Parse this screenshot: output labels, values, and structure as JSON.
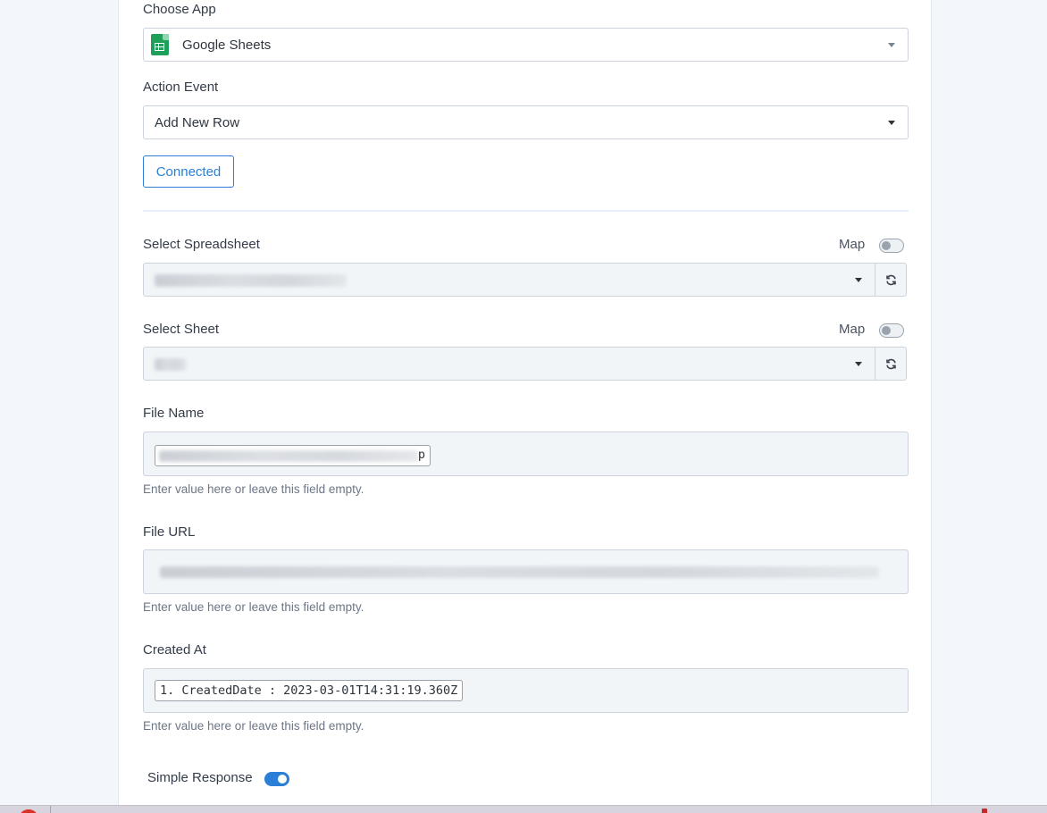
{
  "choose_app": {
    "label": "Choose App",
    "value": "Google Sheets",
    "icon": "google-sheets-icon"
  },
  "action_event": {
    "label": "Action Event",
    "value": "Add New Row"
  },
  "connected_button": "Connected",
  "select_spreadsheet": {
    "label": "Select Spreadsheet",
    "map_label": "Map",
    "map_enabled": false
  },
  "select_sheet": {
    "label": "Select Sheet",
    "map_label": "Map",
    "map_enabled": false
  },
  "file_name": {
    "label": "File Name",
    "chip_suffix": "p",
    "help": "Enter value here or leave this field empty."
  },
  "file_url": {
    "label": "File URL",
    "help": "Enter value here or leave this field empty."
  },
  "created_at": {
    "label": "Created At",
    "chip": "1. CreatedDate : 2023-03-01T14:31:19.360Z",
    "help": "Enter value here or leave this field empty."
  },
  "simple_response": {
    "label": "Simple Response",
    "enabled": true
  },
  "colors": {
    "accent": "#2b7fd6",
    "background": "#f3f6fb",
    "card": "#ffffff",
    "sheets_green": "#1e9f5a"
  }
}
